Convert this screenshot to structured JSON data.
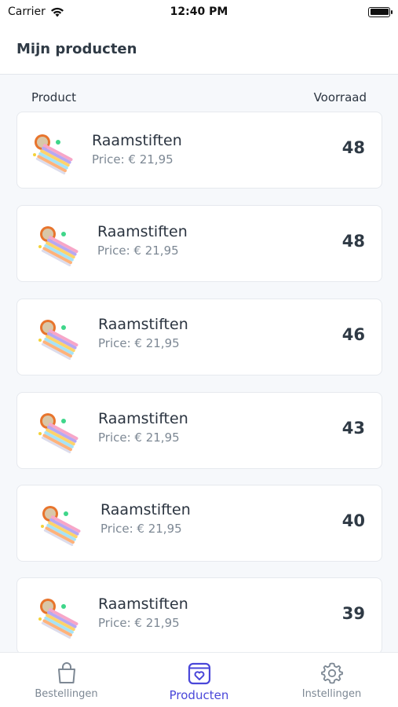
{
  "status_bar": {
    "carrier": "Carrier",
    "time": "12:40 PM"
  },
  "header": {
    "title": "Mijn producten"
  },
  "columns": {
    "product": "Product",
    "stock": "Voorraad"
  },
  "products": [
    {
      "name": "Raamstiften",
      "price": "Price: € 21,95",
      "stock": "48"
    },
    {
      "name": "Raamstiften",
      "price": "Price: € 21,95",
      "stock": "48"
    },
    {
      "name": "Raamstiften",
      "price": "Price: € 21,95",
      "stock": "46"
    },
    {
      "name": "Raamstiften",
      "price": "Price: € 21,95",
      "stock": "43"
    },
    {
      "name": "Raamstiften",
      "price": "Price: € 21,95",
      "stock": "40"
    },
    {
      "name": "Raamstiften",
      "price": "Price: € 21,95",
      "stock": "39"
    }
  ],
  "tabs": [
    {
      "label": "Bestellingen",
      "icon": "shopping-bag-icon",
      "active": false
    },
    {
      "label": "Producten",
      "icon": "product-box-icon",
      "active": true
    },
    {
      "label": "Instellingen",
      "icon": "gear-icon",
      "active": false
    }
  ],
  "colors": {
    "accent": "#4a47d9",
    "muted": "#7d8894",
    "background": "#f6f8fb"
  }
}
